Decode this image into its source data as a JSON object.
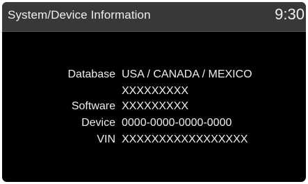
{
  "header": {
    "title": "System/Device Information",
    "clock": "9:30"
  },
  "info": {
    "database": {
      "label": "Database",
      "value_line1": "USA / CANADA / MEXICO",
      "value_line2": "XXXXXXXXX"
    },
    "software": {
      "label": "Software",
      "value": "XXXXXXXXX"
    },
    "device": {
      "label": "Device",
      "value": "0000-0000-0000-0000"
    },
    "vin": {
      "label": "VIN",
      "value": "XXXXXXXXXXXXXXXXX"
    }
  }
}
